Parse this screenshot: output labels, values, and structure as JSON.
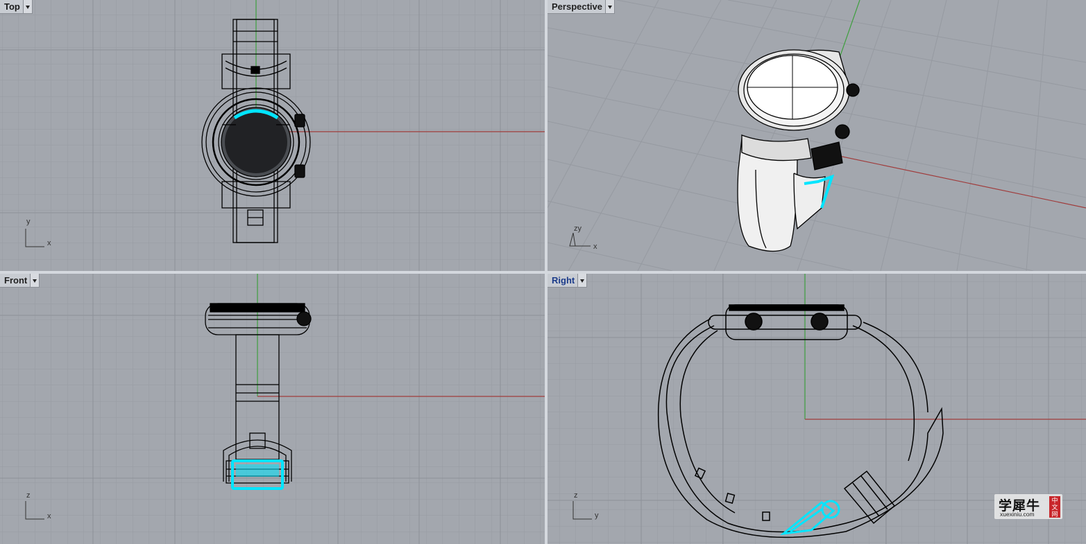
{
  "viewports": {
    "top": {
      "label": "Top",
      "axis_h": "x",
      "axis_v": "y"
    },
    "perspective": {
      "label": "Perspective",
      "axis_h": "x",
      "axis_v": "zy"
    },
    "front": {
      "label": "Front",
      "axis_h": "x",
      "axis_v": "z"
    },
    "right": {
      "label": "Right",
      "axis_h": "y",
      "axis_v": "z"
    }
  },
  "watermark": {
    "title": "学犀牛",
    "url": "xuexiniu.com",
    "badge": "中文网"
  },
  "colors": {
    "viewport_bg": "#a3a7ae",
    "grid": "#969aa1",
    "x_axis": "#a03c3c",
    "y_axis": "#3f9f3f",
    "selection": "#00e5ff",
    "wire": "#000000"
  }
}
